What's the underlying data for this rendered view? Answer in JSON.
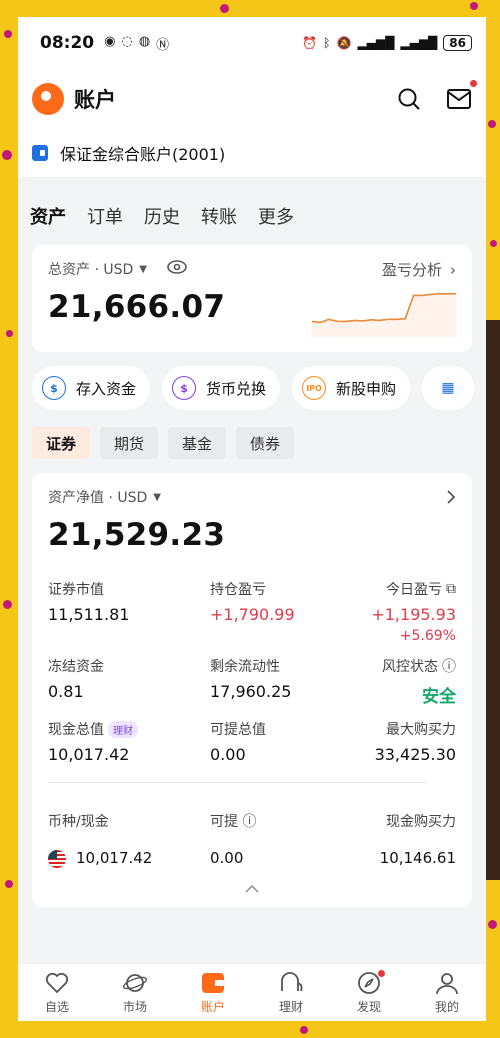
{
  "status": {
    "time": "08:20",
    "battery": "86"
  },
  "header": {
    "title": "账户"
  },
  "account": {
    "label": "保证金综合账户(2001)"
  },
  "tabs": [
    "资产",
    "订单",
    "历史",
    "转账",
    "更多"
  ],
  "total": {
    "label": "总资产 · USD",
    "value": "21,666.07",
    "pl_link": "盈亏分析"
  },
  "sparkline": [
    0.3,
    0.28,
    0.34,
    0.3,
    0.3,
    0.32,
    0.31,
    0.33,
    0.32,
    0.34,
    0.34,
    0.35,
    0.8,
    0.8,
    0.82,
    0.83,
    0.83,
    0.83
  ],
  "actions": [
    {
      "label": "存入资金",
      "icon": "deposit-icon",
      "color": "#1f6fe0"
    },
    {
      "label": "货币兑换",
      "icon": "exchange-icon",
      "color": "#8a3ee6"
    },
    {
      "label": "新股申购",
      "icon": "ipo-icon",
      "color": "#ff8a1a"
    }
  ],
  "subtabs": [
    "证券",
    "期货",
    "基金",
    "债券"
  ],
  "net": {
    "label": "资产净值 · USD",
    "value": "21,529.23",
    "market_value_label": "证券市值",
    "market_value": "11,511.81",
    "position_pl_label": "持仓盈亏",
    "position_pl": "+1,790.99",
    "today_pl_label": "今日盈亏",
    "today_pl": "+1,195.93",
    "today_pct": "+5.69%",
    "frozen_label": "冻结资金",
    "frozen": "0.81",
    "liquidity_label": "剩余流动性",
    "liquidity": "17,960.25",
    "risk_label": "风控状态",
    "risk": "安全",
    "cash_label": "现金总值",
    "cash_badge": "理财",
    "cash": "10,017.42",
    "withdraw_label": "可提总值",
    "withdraw": "0.00",
    "max_buy_label": "最大购买力",
    "max_buy": "33,425.30"
  },
  "currency": {
    "col1": "币种/现金",
    "col2": "可提",
    "col3": "现金购买力",
    "cash": "10,017.42",
    "withdraw": "0.00",
    "buying_power": "10,146.61"
  },
  "nav": [
    "自选",
    "市场",
    "账户",
    "理财",
    "发现",
    "我的"
  ]
}
